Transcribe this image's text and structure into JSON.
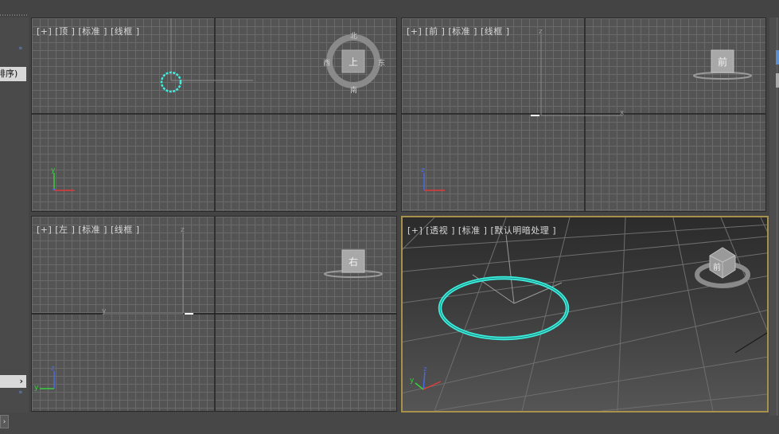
{
  "left_panel": {
    "collapse_chevrons": "»",
    "sort_tab_label": "排序)",
    "expand_arrow": "›"
  },
  "viewports": {
    "top": {
      "label": "[+] [顶 ] [标准 ] [线框 ]",
      "cube_face": "上",
      "compass": {
        "n": "北",
        "s": "南",
        "e": "东",
        "w": "西"
      }
    },
    "front": {
      "label": "[+] [前 ] [标准 ] [线框 ]",
      "cube_face": "前"
    },
    "left": {
      "label": "[+] [左 ] [标准 ] [线框 ]",
      "cube_face": "右"
    },
    "persp": {
      "label": "[+] [透视 ] [标准 ] [默认明暗处理 ]",
      "cube_face": "前"
    }
  },
  "axis_labels": {
    "x": "x",
    "y": "y",
    "z": "z"
  },
  "colors": {
    "selection_cyan": "#3cf0e0",
    "active_viewport_border": "#a8914a",
    "axis_x": "#e03a3a",
    "axis_y": "#3ad03a",
    "axis_z": "#4a6ae0"
  }
}
